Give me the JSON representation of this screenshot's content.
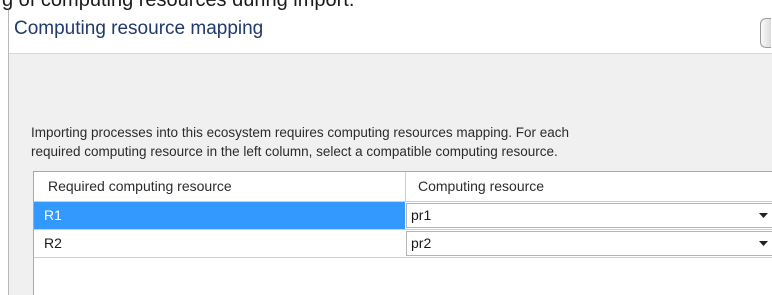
{
  "caption": {
    "text": "g of computing resources during import."
  },
  "dialog": {
    "title": "Computing resource mapping",
    "description_line1": "Importing processes into this ecosystem requires computing resources mapping. For each",
    "description_line2": "required computing resource in the left column, select a compatible computing resource."
  },
  "grid": {
    "columns": [
      "Required computing resource",
      "Computing resource"
    ],
    "rows": [
      {
        "required": "R1",
        "computing": "pr1",
        "selected": true
      },
      {
        "required": "R2",
        "computing": "pr2",
        "selected": false
      }
    ]
  },
  "icons": {
    "dropdown": "chevron-down-icon",
    "scroll": "scrollbar-handle"
  },
  "colors": {
    "title": "#1f3a6b",
    "selection": "#3399ff",
    "panel": "#f0f0f0"
  }
}
